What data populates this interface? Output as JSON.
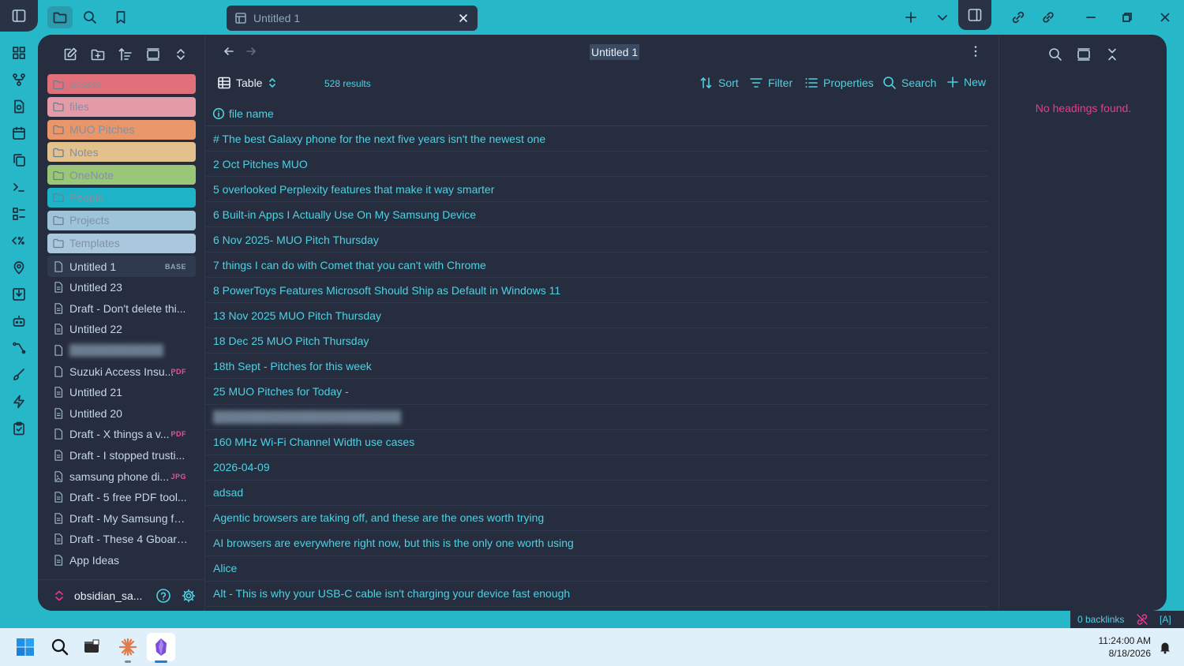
{
  "tab": {
    "title": "Untitled 1"
  },
  "explorer": {
    "folders": [
      {
        "label": "assets",
        "color": "#e0707a"
      },
      {
        "label": "files",
        "color": "#e59aa8"
      },
      {
        "label": "MUO Pitches",
        "color": "#e8966a"
      },
      {
        "label": "Notes",
        "color": "#e3c18c"
      },
      {
        "label": "OneNote",
        "color": "#9ac777"
      },
      {
        "label": "People",
        "color": "#1fb3c7"
      },
      {
        "label": "Projects",
        "color": "#9ec4d9"
      },
      {
        "label": "Templates",
        "color": "#a9c8de"
      }
    ],
    "files": [
      {
        "label": "Untitled 1",
        "badge": "BASE",
        "active": true,
        "icon": "file-icon"
      },
      {
        "label": "Untitled 23",
        "badge": "",
        "icon": "file-text-icon"
      },
      {
        "label": "Draft - Don't delete thi...",
        "badge": "",
        "icon": "file-text-icon"
      },
      {
        "label": "Untitled 22",
        "badge": "",
        "icon": "file-text-icon"
      },
      {
        "label": "",
        "badge": "",
        "blurred": true,
        "icon": "file-icon"
      },
      {
        "label": "Suzuki Access Insu...",
        "badge": "PDF",
        "icon": "file-icon"
      },
      {
        "label": "Untitled 21",
        "badge": "",
        "icon": "file-text-icon"
      },
      {
        "label": "Untitled 20",
        "badge": "",
        "icon": "file-text-icon"
      },
      {
        "label": "Draft - X things a v...",
        "badge": "PDF",
        "icon": "file-icon"
      },
      {
        "label": "Draft - I stopped trusti...",
        "badge": "",
        "icon": "file-text-icon"
      },
      {
        "label": "samsung phone di...",
        "badge": "JPG",
        "icon": "image-file-icon"
      },
      {
        "label": "Draft  - 5 free PDF tool...",
        "badge": "",
        "icon": "file-text-icon"
      },
      {
        "label": "Draft - My Samsung fel...",
        "badge": "",
        "icon": "file-text-icon"
      },
      {
        "label": "Draft - These 4 Gboard...",
        "badge": "",
        "icon": "file-text-icon"
      },
      {
        "label": "App Ideas",
        "badge": "",
        "icon": "file-text-icon"
      }
    ],
    "vault_name": "obsidian_sa..."
  },
  "content": {
    "title": "Untitled 1",
    "view_name": "Table",
    "results": "528 results",
    "toolbar": {
      "sort": "Sort",
      "filter": "Filter",
      "properties": "Properties",
      "search": "Search",
      "new": "New"
    },
    "column": "file name",
    "rows": [
      "# The best Galaxy phone for the next five years isn't the newest one",
      "2 Oct Pitches MUO",
      "5 overlooked Perplexity features that make it way smarter",
      "6 Built-in Apps I Actually Use On My Samsung Device",
      "6 Nov 2025- MUO Pitch Thursday",
      "7 things I can do with Comet that you can't with Chrome",
      "8 PowerToys Features Microsoft Should Ship as Default in Windows 11",
      "13 Nov 2025 MUO Pitch Thursday",
      "18 Dec 25 MUO Pitch Thursday",
      "18th Sept - Pitches for this week",
      "25 MUO Pitches for Today -",
      "",
      "160 MHz Wi-Fi Channel Width use cases",
      "2026-04-09",
      "adsad",
      "Agentic browsers are taking off, and these are the ones worth trying",
      "AI browsers are everywhere right now, but this is the only one worth using",
      "Alice",
      "Alt - This is why your USB-C cable isn't charging your device fast enough"
    ]
  },
  "outline": {
    "empty": "No headings found."
  },
  "status": {
    "backlinks": "0 backlinks",
    "mode": "[A]"
  },
  "taskbar": {
    "time": "11:24:00 AM",
    "date": "8/18/2026"
  },
  "colors": {
    "accent": "#4fd1e2",
    "frame": "#26b7c9",
    "panel": "#262d3e",
    "warning": "#f0388f"
  }
}
